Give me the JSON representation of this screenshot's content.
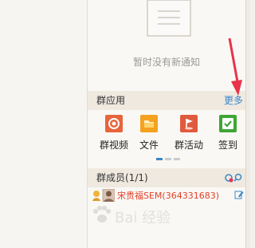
{
  "notifications": {
    "empty_text": "暂时没有新通知",
    "empty_icon": "document-icon"
  },
  "apps": {
    "title": "群应用",
    "more": "更多",
    "items": [
      {
        "label": "群视频",
        "icon": "video-call-icon",
        "color": "#e8643c"
      },
      {
        "label": "文件",
        "icon": "folder-icon",
        "color": "#f4a21f"
      },
      {
        "label": "群活动",
        "icon": "flag-icon",
        "color": "#e05a3d"
      },
      {
        "label": "签到",
        "icon": "checkbox-icon",
        "color": "#3fa536"
      }
    ]
  },
  "members": {
    "title": "群成员(1/1)",
    "list": [
      {
        "name": "宋贵福SEM(364331683)",
        "color": "#e0402a"
      }
    ]
  },
  "watermark": {
    "text": "Bai 经验"
  },
  "colors": {
    "accent": "#3a87c9",
    "arrow": "#e8334a"
  }
}
